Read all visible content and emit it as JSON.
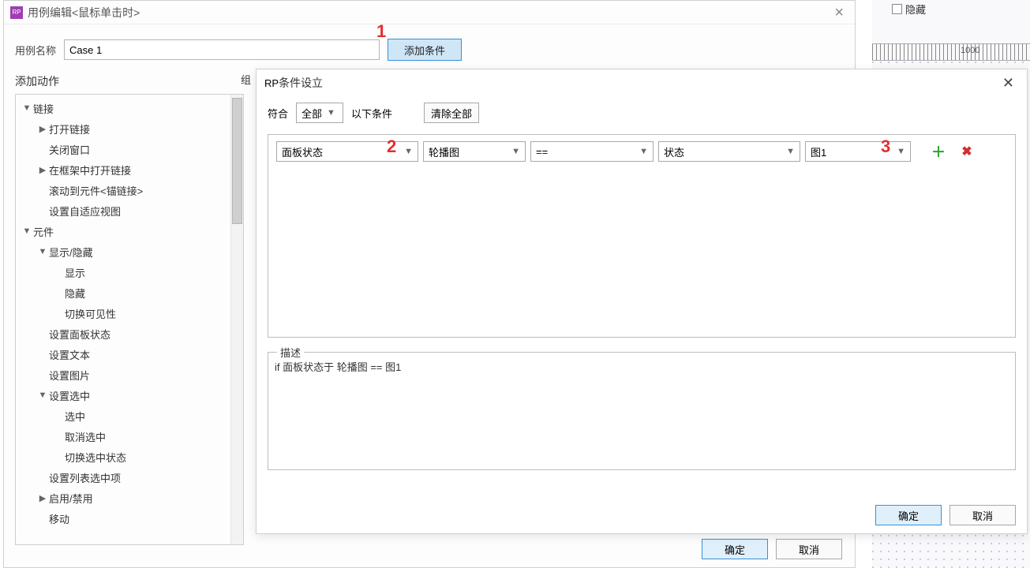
{
  "back": {
    "hidden_checkbox_label": "隐藏",
    "ruler_label": "1000"
  },
  "dlg1": {
    "title": "用例编辑<鼠标单击时>",
    "case_name_label": "用例名称",
    "case_name_value": "Case 1",
    "add_condition_btn": "添加条件",
    "add_action_header": "添加动作",
    "group_header": "组",
    "ok": "确定",
    "cancel": "取消"
  },
  "tree": [
    {
      "lvl": 0,
      "arrow": "▼",
      "label": "链接"
    },
    {
      "lvl": 1,
      "arrow": "▶",
      "label": "打开链接"
    },
    {
      "lvl": 1,
      "arrow": "",
      "label": "关闭窗口"
    },
    {
      "lvl": 1,
      "arrow": "▶",
      "label": "在框架中打开链接"
    },
    {
      "lvl": 1,
      "arrow": "",
      "label": "滚动到元件<锚链接>"
    },
    {
      "lvl": 1,
      "arrow": "",
      "label": "设置自适应视图"
    },
    {
      "lvl": 0,
      "arrow": "▼",
      "label": "元件"
    },
    {
      "lvl": 1,
      "arrow": "▼",
      "label": "显示/隐藏"
    },
    {
      "lvl": 2,
      "arrow": "",
      "label": "显示"
    },
    {
      "lvl": 2,
      "arrow": "",
      "label": "隐藏"
    },
    {
      "lvl": 2,
      "arrow": "",
      "label": "切换可见性"
    },
    {
      "lvl": 1,
      "arrow": "",
      "label": "设置面板状态"
    },
    {
      "lvl": 1,
      "arrow": "",
      "label": "设置文本"
    },
    {
      "lvl": 1,
      "arrow": "",
      "label": "设置图片"
    },
    {
      "lvl": 1,
      "arrow": "▼",
      "label": "设置选中"
    },
    {
      "lvl": 2,
      "arrow": "",
      "label": "选中"
    },
    {
      "lvl": 2,
      "arrow": "",
      "label": "取消选中"
    },
    {
      "lvl": 2,
      "arrow": "",
      "label": "切换选中状态"
    },
    {
      "lvl": 1,
      "arrow": "",
      "label": "设置列表选中项"
    },
    {
      "lvl": 1,
      "arrow": "▶",
      "label": "启用/禁用"
    },
    {
      "lvl": 1,
      "arrow": "",
      "label": "移动"
    }
  ],
  "annotations": {
    "a1": "1",
    "a2": "2",
    "a3": "3"
  },
  "dlg2": {
    "title": "条件设立",
    "match_label_pre": "符合",
    "match_select": "全部",
    "match_label_post": "以下条件",
    "clear_all_btn": "清除全部",
    "desc_legend": "描述",
    "desc_text": "if 面板状态于 轮播图 == 图1",
    "ok": "确定",
    "cancel": "取消"
  },
  "cond": {
    "field1": "面板状态",
    "field2": "轮播图",
    "field3": "==",
    "field4": "状态",
    "field5": "图1"
  }
}
